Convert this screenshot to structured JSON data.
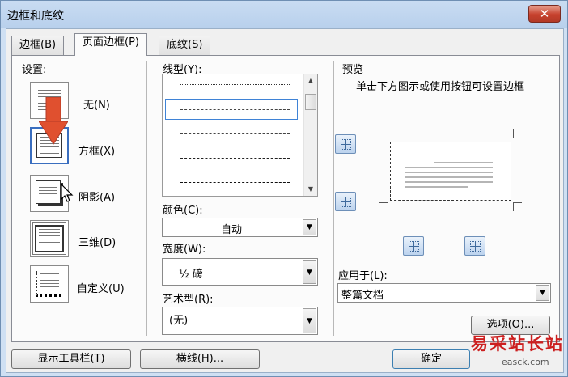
{
  "window": {
    "title": "边框和底纹",
    "close_glyph": "✕"
  },
  "tabs": [
    {
      "label": "边框(B)"
    },
    {
      "label": "页面边框(P)"
    },
    {
      "label": "底纹(S)"
    }
  ],
  "settings": {
    "label": "设置:",
    "items": [
      {
        "label": "无(N)"
      },
      {
        "label": "方框(X)"
      },
      {
        "label": "阴影(A)"
      },
      {
        "label": "三维(D)"
      },
      {
        "label": "自定义(U)"
      }
    ],
    "selected": "方框(X)"
  },
  "line_style": {
    "label": "线型(Y):"
  },
  "color": {
    "label": "颜色(C):",
    "value": "自动"
  },
  "width": {
    "label": "宽度(W):",
    "value": "½ 磅"
  },
  "art": {
    "label": "艺术型(R):",
    "value": "(无)"
  },
  "preview": {
    "label": "预览",
    "hint": "单击下方图示或使用按钮可设置边框"
  },
  "apply_to": {
    "label": "应用于(L):",
    "value": "整篇文档"
  },
  "buttons": {
    "options": "选项(O)...",
    "show_toolbar": "显示工具栏(T)",
    "horizontal_line": "横线(H)...",
    "ok": "确定"
  },
  "watermark": {
    "text": "易采站长站",
    "sub": "easck.com"
  }
}
